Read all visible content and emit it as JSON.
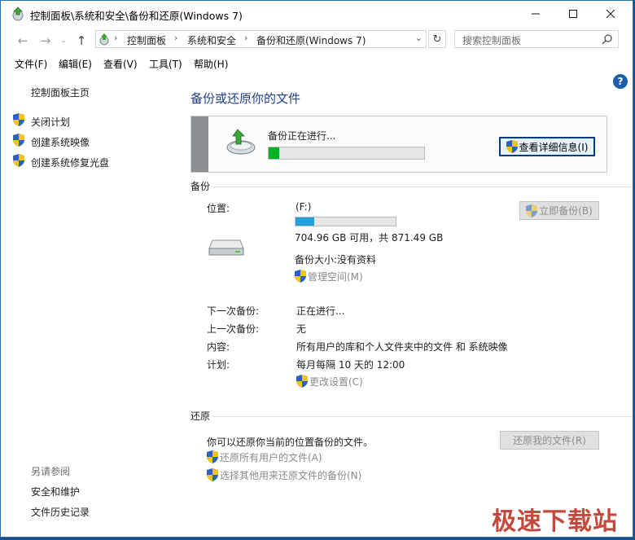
{
  "window": {
    "title": "控制面板\\系统和安全\\备份和还原(Windows 7)"
  },
  "address": {
    "crumbs": [
      "控制面板",
      "系统和安全",
      "备份和还原(Windows 7)"
    ],
    "search_placeholder": "搜索控制面板"
  },
  "menu": [
    "文件(F)",
    "编辑(E)",
    "查看(V)",
    "工具(T)",
    "帮助(H)"
  ],
  "sidebar": {
    "home": "控制面板主页",
    "tasks": [
      "关闭计划",
      "创建系统映像",
      "创建系统修复光盘"
    ],
    "see_also_heading": "另请参阅",
    "see_also": [
      "安全和维护",
      "文件历史记录"
    ]
  },
  "main": {
    "title": "备份或还原你的文件",
    "status": {
      "text": "备份正在进行...",
      "progress_percent": 7,
      "details_button": "查看详细信息(I)"
    },
    "backup": {
      "section": "备份",
      "location_label": "位置:",
      "drive": "(F:)",
      "drive_used_percent": 19,
      "free_space": "704.96 GB 可用，共 871.49 GB",
      "backup_size": "备份大小:没有资料",
      "manage_space": "管理空间(M)",
      "backup_now": "立即备份(B)",
      "rows": [
        {
          "label": "下一次备份:",
          "value": "正在进行..."
        },
        {
          "label": "上一次备份:",
          "value": "无"
        },
        {
          "label": "内容:",
          "value": "所有用户的库和个人文件夹中的文件 和 系统映像"
        },
        {
          "label": "计划:",
          "value": "每月每隔 10 天的 12:00"
        }
      ],
      "change_settings": "更改设置(C)"
    },
    "restore": {
      "section": "还原",
      "text": "你可以还原你当前的位置备份的文件。",
      "restore_my_files": "还原我的文件(R)",
      "restore_all_users": "还原所有用户的文件(A)",
      "select_other": "选择其他用来还原文件的备份(N)"
    }
  },
  "watermark": "极速下载站",
  "colors": {
    "accent": "#1e3e8a",
    "progress_green": "#06b025",
    "drive_blue": "#26a0da",
    "watermark": "#c0392b"
  }
}
